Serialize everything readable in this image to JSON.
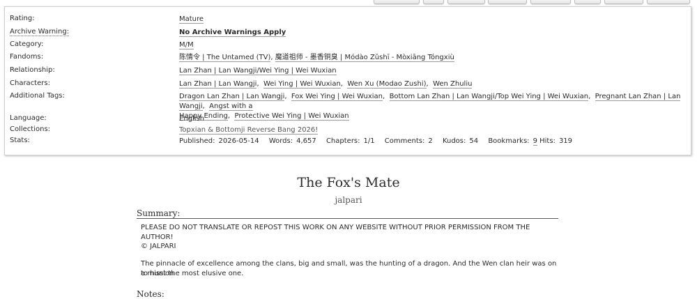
{
  "meta": {
    "rating": {
      "label": "Rating:",
      "value": "Mature"
    },
    "warning": {
      "label": "Archive Warning:",
      "value": "No Archive Warnings Apply"
    },
    "category": {
      "label": "Category:",
      "value": "M/M"
    },
    "fandoms": {
      "label": "Fandoms:",
      "items": [
        "陈情令 | The Untamed (TV)",
        "魔道祖师 - 墨香铜臭 | Módào Zǔshī - Mòxiāng Tóngxiù"
      ]
    },
    "relationship": {
      "label": "Relationship:",
      "value": "Lan Zhan | Lan Wangji/Wei Ying | Wei Wuxian"
    },
    "characters": {
      "label": "Characters:",
      "items": [
        "Lan Zhan | Lan Wangji",
        "Wei Ying | Wei Wuxian",
        "Wen Xu (Modao Zushi)",
        "Wen Zhuliu"
      ]
    },
    "tags": {
      "label": "Additional Tags:",
      "items": [
        "Dragon Lan Zhan | Lan Wangji",
        "Fox Wei Ying | Wei Wuxian",
        "Bottom Lan Zhan | Lan Wangji/Top Wei Ying | Wei Wuxian",
        "Pregnant Lan Zhan | Lan Wangji",
        "Angst with a",
        "Happy Ending",
        "Protective Wei Ying | Wei Wuxian"
      ]
    },
    "language": {
      "label": "Language:",
      "value": "English"
    },
    "collections": {
      "label": "Collections:",
      "value": "Topxian & Bottomji Reverse Bang 2026!"
    },
    "stats": {
      "label": "Stats:",
      "published_label": "Published:",
      "published": "2026-05-14",
      "words_label": "Words:",
      "words": "4,657",
      "chapters_label": "Chapters:",
      "chapters": "1/1",
      "comments_label": "Comments:",
      "comments": "2",
      "kudos_label": "Kudos:",
      "kudos": "54",
      "bookmarks_label": "Bookmarks:",
      "bookmarks": "9",
      "hits_label": "Hits:",
      "hits": "319"
    }
  },
  "work": {
    "title": "The Fox's Mate",
    "author": "jalpari",
    "summary_heading": "Summary:",
    "summary": [
      "PLEASE DO NOT TRANSLATE OR REPOST THIS WORK ON ANY WEBSITE WITHOUT PRIOR PERMISSION FROM THE AUTHOR!",
      "© JALPARI",
      "The pinnacle of excellence among the clans, big and small, was the hunting of a dragon. And the Wen clan heir was on a mission",
      "to hunt the most elusive one."
    ],
    "notes_heading": "Notes:"
  }
}
